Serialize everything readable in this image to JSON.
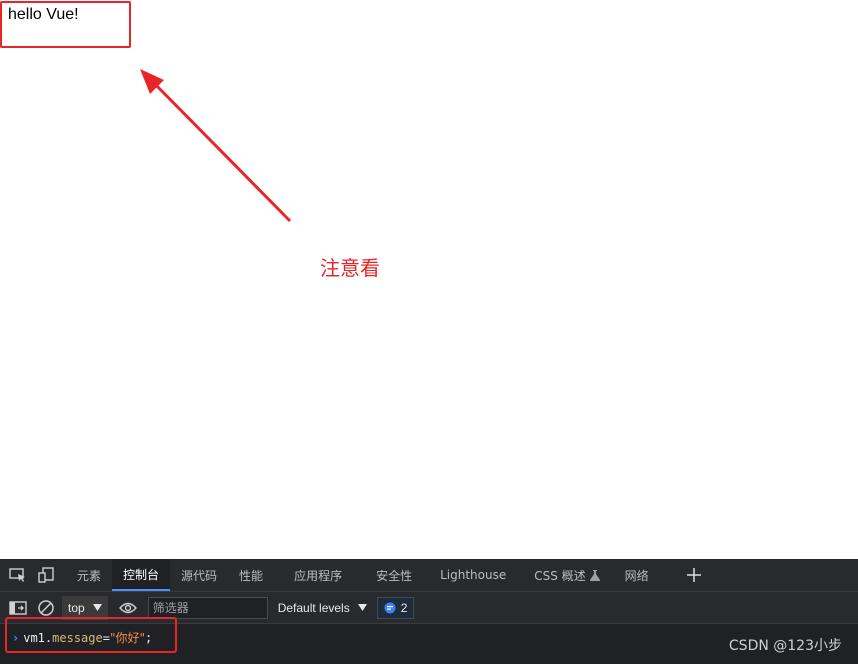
{
  "page": {
    "hello_text": "hello Vue!",
    "note_text": "注意看"
  },
  "devtools": {
    "tabs": [
      {
        "label": "元素"
      },
      {
        "label": "控制台",
        "active": true
      },
      {
        "label": "源代码"
      },
      {
        "label": "性能"
      },
      {
        "label": "应用程序"
      },
      {
        "label": "安全性"
      },
      {
        "label": "Lighthouse"
      },
      {
        "label": "CSS 概述"
      },
      {
        "label": "网络"
      }
    ],
    "toolbar": {
      "context": "top",
      "filter_placeholder": "筛选器",
      "levels": "Default levels",
      "issues_count": "2"
    },
    "console": {
      "object": "vm1",
      "dot": ".",
      "property": "message",
      "operator": "=",
      "string": "\"你好\"",
      "terminator": ";"
    }
  },
  "watermark": "CSDN @123小步",
  "colors": {
    "annotation_red": "#e8262a",
    "devtools_bg": "#202124",
    "active_tab_underline": "#4d90fe"
  },
  "icons": {
    "inspect": "inspect-element-icon",
    "device": "device-toolbar-icon",
    "sidebar": "show-sidebar-icon",
    "clear": "clear-console-icon",
    "eye": "live-expression-icon",
    "issues": "issues-chat-icon",
    "beaker": "experimental-beaker-icon",
    "add": "plus-icon"
  }
}
